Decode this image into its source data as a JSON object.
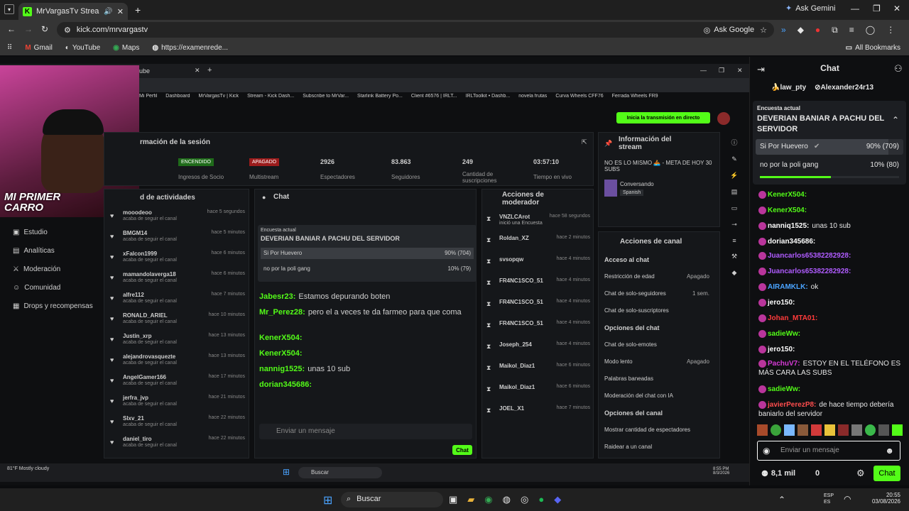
{
  "browser": {
    "tab_title": "MrVargasTv Stream - Watch",
    "url": "kick.com/mrvargastv",
    "ask_gemini": "Ask Gemini",
    "ask_google": "Ask Google",
    "all_bookmarks": "All Bookmarks",
    "bookmarks": [
      "Gmail",
      "YouTube",
      "Maps",
      "https://examenrede..."
    ]
  },
  "stream": {
    "webcam_caption": "MI PRIMER CARRO",
    "inner_tab": "ube",
    "inner_bookmarks": [
      "Mi Perfil",
      "Dashboard",
      "MrVargasTv | Kick",
      "Stream - Kick Dash...",
      "Subscribe to MrVar...",
      "Starlink Battery Po...",
      "Client #6576 | IRLT...",
      "IRLToolkit • Dashb...",
      "novela frutas",
      "Curva Wheels CFF76",
      "Ferrada Wheels FR9"
    ],
    "go_live": "Inicia la transmisión en directo",
    "session_title": "rmación de la sesión",
    "stats": [
      {
        "value": "ENCENDIDO",
        "label": "Ingresos de Socio"
      },
      {
        "value": "APAGADO",
        "label": "Multistream"
      },
      {
        "value": "2926",
        "label": "Espectadores"
      },
      {
        "value": "83.863",
        "label": "Seguidores"
      },
      {
        "value": "249",
        "label": "Cantidad de suscripciones"
      },
      {
        "value": "03:57:10",
        "label": "Tiempo en vivo"
      }
    ],
    "stream_info_title": "Información del stream",
    "stream_title": "NO ES LO MISMO 🚣 - META DE HOY 30 SUBS",
    "category": "Conversando",
    "language": "Spanish",
    "side_nav": [
      "Estudio",
      "Analíticas",
      "Moderación",
      "Comunidad",
      "Drops y recompensas"
    ],
    "activity_title": "d de actividades",
    "activity": [
      {
        "user": "mooodeoo",
        "time": "hace 5 segundos"
      },
      {
        "user": "BMGM14",
        "time": "hace 5 minutos"
      },
      {
        "user": "xFalcon1999",
        "time": "hace 6 minutos"
      },
      {
        "user": "mamandolaverga18",
        "time": "hace 6 minutos"
      },
      {
        "user": "alfre112",
        "time": "hace 7 minutos"
      },
      {
        "user": "RONALD_ARIEL",
        "time": "hace 10 minutos"
      },
      {
        "user": "Justin_xrp",
        "time": "hace 13 minutos"
      },
      {
        "user": "alejandrovasquezte",
        "time": "hace 13 minutos"
      },
      {
        "user": "AngelGamer166",
        "time": "hace 17 minutos"
      },
      {
        "user": "jerfra_jvp",
        "time": "hace 21 minutos"
      },
      {
        "user": "Slxv_21",
        "time": "hace 22 minutos"
      },
      {
        "user": "daniel_tiro",
        "time": "hace 22 minutos"
      }
    ],
    "activity_sub": "acaba de seguir el canal",
    "inner_chat_title": "Chat",
    "inner_poll_label": "Encuesta actual",
    "inner_poll_q": "DEVERIAN BANIAR A PACHU DEL SERVIDOR",
    "inner_poll_opt1": "Si Por Huevero",
    "inner_poll_pct1": "90% (704)",
    "inner_poll_opt2": "no por la poli gang",
    "inner_poll_pct2": "10% (79)",
    "inner_msgs": [
      {
        "user": "Jabesr23:",
        "text": "Estamos depurando boten"
      },
      {
        "user": "Mr_Perez28:",
        "text": "pero el a veces te da farmeo para que coma"
      },
      {
        "user": "KenerX504:",
        "text": ""
      },
      {
        "user": "KenerX504:",
        "text": ""
      },
      {
        "user": "nannig1525:",
        "text": "unas 10 sub"
      },
      {
        "user": "dorian345686:",
        "text": ""
      }
    ],
    "inner_input": "Enviar un mensaje",
    "inner_chat_btn": "Chat",
    "mod_title": "Acciones de moderador",
    "mod_actions": [
      {
        "user": "VNZLCArot",
        "text": "inició una Encuesta",
        "time": "hace 58 segundos"
      },
      {
        "user": "Roldan_XZ",
        "time": "hace 2 minutos"
      },
      {
        "user": "svsopqw",
        "time": "hace 4 minutos"
      },
      {
        "user": "FR4NC1SCO_51",
        "time": "hace 4 minutos"
      },
      {
        "user": "FR4NC1SCO_51",
        "time": "hace 4 minutos"
      },
      {
        "user": "FR4NC1SCO_51",
        "time": "hace 4 minutos"
      },
      {
        "user": "Joseph_254",
        "time": "hace 4 minutos"
      },
      {
        "user": "Maikol_Diaz1",
        "time": "hace 6 minutos"
      },
      {
        "user": "Maikol_Diaz1",
        "time": "hace 6 minutos"
      },
      {
        "user": "JOEL_X1",
        "time": "hace 7 minutos"
      }
    ],
    "channel_title": "Acciones de canal",
    "channel_items": [
      {
        "h": "Acceso al chat"
      },
      {
        "l": "Restricción de edad",
        "v": "Apagado"
      },
      {
        "l": "Chat de solo-seguidores",
        "v": "1 sem."
      },
      {
        "l": "Chat de solo-suscriptores"
      },
      {
        "h": "Opciones del chat"
      },
      {
        "l": "Chat de solo-emotes"
      },
      {
        "l": "Modo lento",
        "v": "Apagado"
      },
      {
        "l": "Palabras baneadas"
      },
      {
        "l": "Moderación del chat con IA"
      },
      {
        "h": "Opciones del canal"
      },
      {
        "l": "Mostrar cantidad de espectadores"
      },
      {
        "l": "Raidear a un canal"
      }
    ],
    "inner_weather": "81°F Mostly cloudy",
    "inner_search": "Buscar",
    "inner_time": "8:55 PM 8/3/2026"
  },
  "chat": {
    "title": "Chat",
    "top_users": [
      "law_pty",
      "Alexander24r13"
    ],
    "poll_label": "Encuesta actual",
    "poll_question": "DEVERIAN BANIAR A PACHU DEL SERVIDOR",
    "opt1": "Si Por Huevero",
    "pct1": "90% (709)",
    "fill1": 0.9,
    "opt2": "no por la poli gang",
    "pct2": "10% (80)",
    "fill2": 0.1,
    "messages": [
      {
        "user": "KenerX504:",
        "text": "",
        "color": "#53fc18"
      },
      {
        "user": "KenerX504:",
        "text": "",
        "color": "#53fc18"
      },
      {
        "user": "nanniq1525:",
        "text": "unas 10 sub",
        "color": "#ffffff"
      },
      {
        "user": "dorian345686:",
        "text": "",
        "color": "#ffffff"
      },
      {
        "user": "Juancarlos65382282928:",
        "text": "",
        "color": "#b05cff"
      },
      {
        "user": "Juancarlos65382282928:",
        "text": "",
        "color": "#b05cff"
      },
      {
        "user": "AIRAMKLK:",
        "text": "ok",
        "color": "#4aa3ff"
      },
      {
        "user": "jero150:",
        "text": "",
        "color": "#ffffff"
      },
      {
        "user": "Johan_MTA01:",
        "text": "",
        "color": "#ff3b3b"
      },
      {
        "user": "sadieWw:",
        "text": "",
        "color": "#53fc18"
      },
      {
        "user": "jero150:",
        "text": "",
        "color": "#ffffff"
      },
      {
        "user": "PachuV7:",
        "text": "ESTOY EN EL TELÉFONO ES MÁS CARA LAS SUBS",
        "color": "#d63ad6"
      },
      {
        "user": "sadieWw:",
        "text": "",
        "color": "#53fc18"
      },
      {
        "user": "javierPerezP8:",
        "text": "de hace tiempo debería baniarlo del servidor",
        "color": "#ff4d4d"
      }
    ],
    "input_placeholder": "Enviar un mensaje",
    "viewers": "8,1 mil",
    "points": "0",
    "send": "Chat"
  },
  "taskbar": {
    "search": "Buscar",
    "lang": "ESP ES",
    "time": "20:55",
    "date": "03/08/2026"
  }
}
